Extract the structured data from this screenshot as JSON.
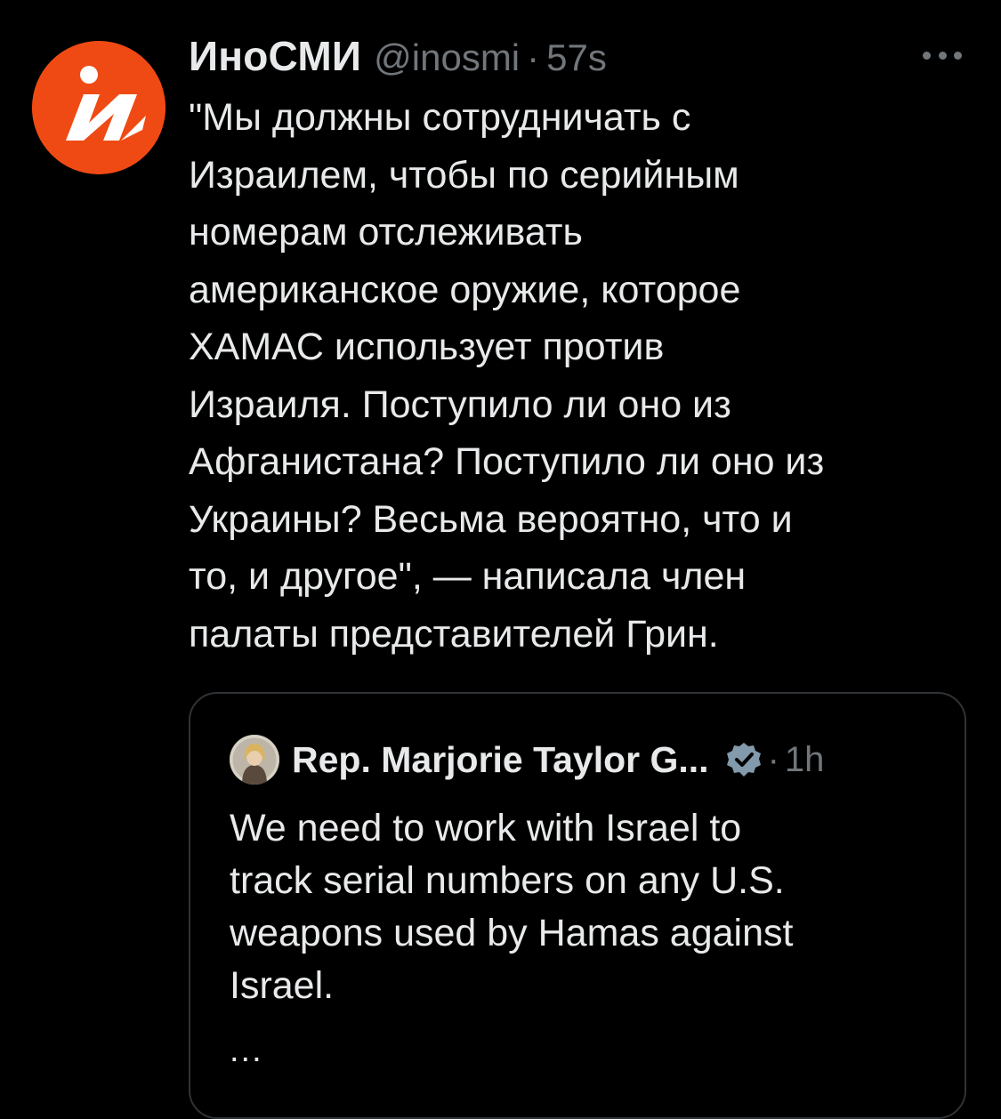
{
  "tweet": {
    "display_name": "ИноСМИ",
    "handle": "@inosmi",
    "separator": "·",
    "time": "57s",
    "avatar_letter": "И",
    "text_lines": [
      "\"Мы должны сотрудничать с",
      "Израилем, чтобы по серийным",
      "номерам отслеживать",
      "американское оружие, которое",
      "ХАМАС использует против",
      "Израиля. Поступило ли оно из",
      "Афганистана? Поступило ли оно из",
      "Украины? Весьма вероятно, что и",
      "то, и другое\", — написала член",
      "палаты представителей Грин."
    ]
  },
  "quoted_tweet": {
    "display_name": "Rep. Marjorie Taylor G...",
    "separator": "·",
    "time": "1h",
    "text_lines": [
      "We need to work with Israel to",
      "track serial numbers on any U.S.",
      "weapons used by Hamas against",
      "Israel."
    ],
    "truncation": "..."
  },
  "colors": {
    "background": "#000000",
    "text_primary": "#e7e9ea",
    "text_secondary": "#71767b",
    "avatar_orange": "#ef4a14",
    "border": "#2f3336",
    "verified_gray": "#829aab"
  },
  "icons": {
    "more": "more-horizontal-icon",
    "verified": "verified-badge-icon"
  }
}
